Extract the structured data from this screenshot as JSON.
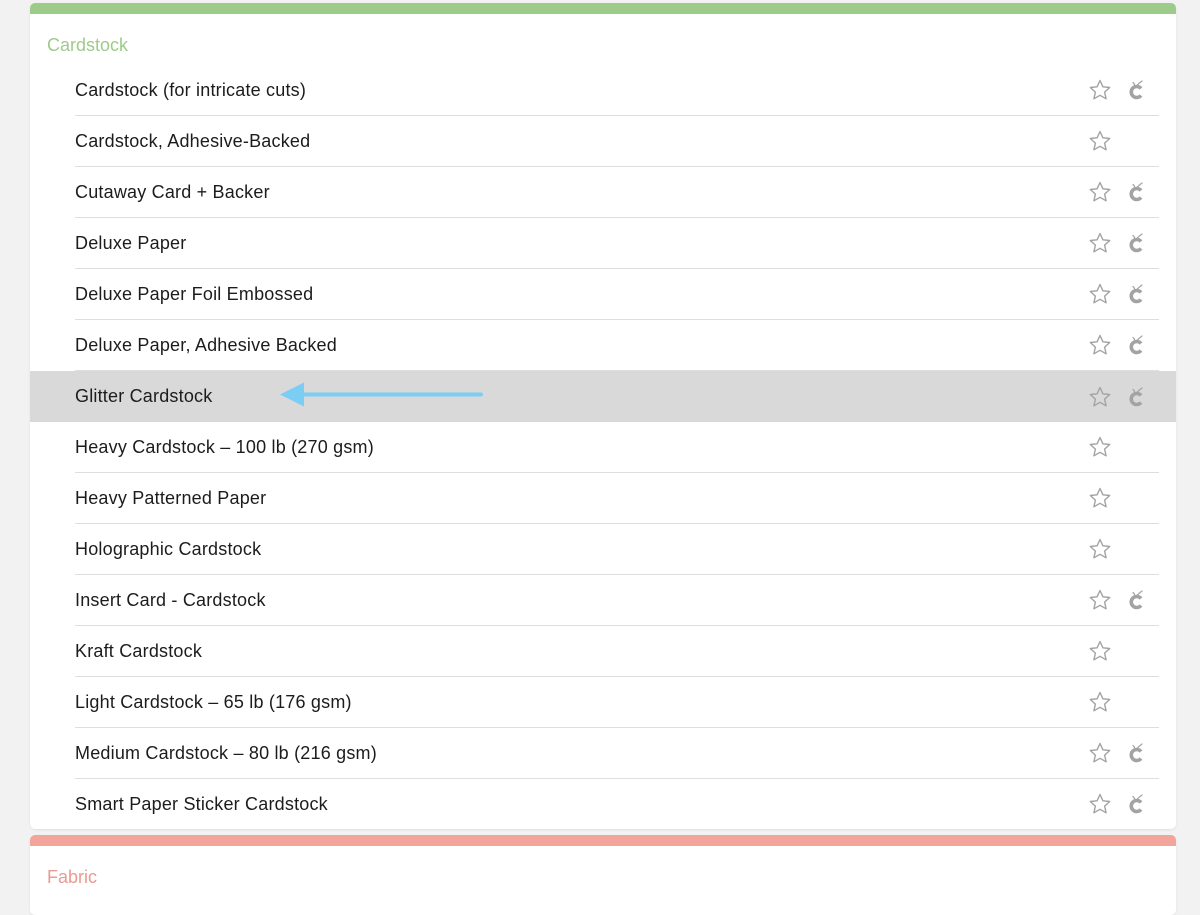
{
  "sections": [
    {
      "title": "Cardstock",
      "accent_color": "#9dcc8a",
      "items": [
        {
          "label": "Cardstock (for intricate cuts)",
          "favorite": false,
          "cricut_badge": true
        },
        {
          "label": "Cardstock, Adhesive-Backed",
          "favorite": false,
          "cricut_badge": false
        },
        {
          "label": "Cutaway Card + Backer",
          "favorite": false,
          "cricut_badge": true
        },
        {
          "label": "Deluxe Paper",
          "favorite": false,
          "cricut_badge": true
        },
        {
          "label": "Deluxe Paper Foil Embossed",
          "favorite": false,
          "cricut_badge": true
        },
        {
          "label": "Deluxe Paper, Adhesive Backed",
          "favorite": false,
          "cricut_badge": true
        },
        {
          "label": "Glitter Cardstock",
          "favorite": false,
          "cricut_badge": true,
          "highlighted": true
        },
        {
          "label": "Heavy Cardstock – 100 lb (270 gsm)",
          "favorite": false,
          "cricut_badge": false
        },
        {
          "label": "Heavy Patterned Paper",
          "favorite": false,
          "cricut_badge": false
        },
        {
          "label": "Holographic Cardstock",
          "favorite": false,
          "cricut_badge": false
        },
        {
          "label": "Insert Card - Cardstock",
          "favorite": false,
          "cricut_badge": true
        },
        {
          "label": "Kraft Cardstock",
          "favorite": false,
          "cricut_badge": false
        },
        {
          "label": "Light Cardstock – 65 lb (176 gsm)",
          "favorite": false,
          "cricut_badge": false
        },
        {
          "label": "Medium Cardstock – 80 lb (216 gsm)",
          "favorite": false,
          "cricut_badge": true
        },
        {
          "label": "Smart Paper Sticker Cardstock",
          "favorite": false,
          "cricut_badge": true
        }
      ]
    },
    {
      "title": "Fabric",
      "accent_color": "#f2a59b",
      "items": []
    }
  ],
  "annotation": {
    "type": "arrow",
    "color": "#7ccdf4",
    "points_to": "Glitter Cardstock"
  },
  "icon_color": "#a3a3a3"
}
